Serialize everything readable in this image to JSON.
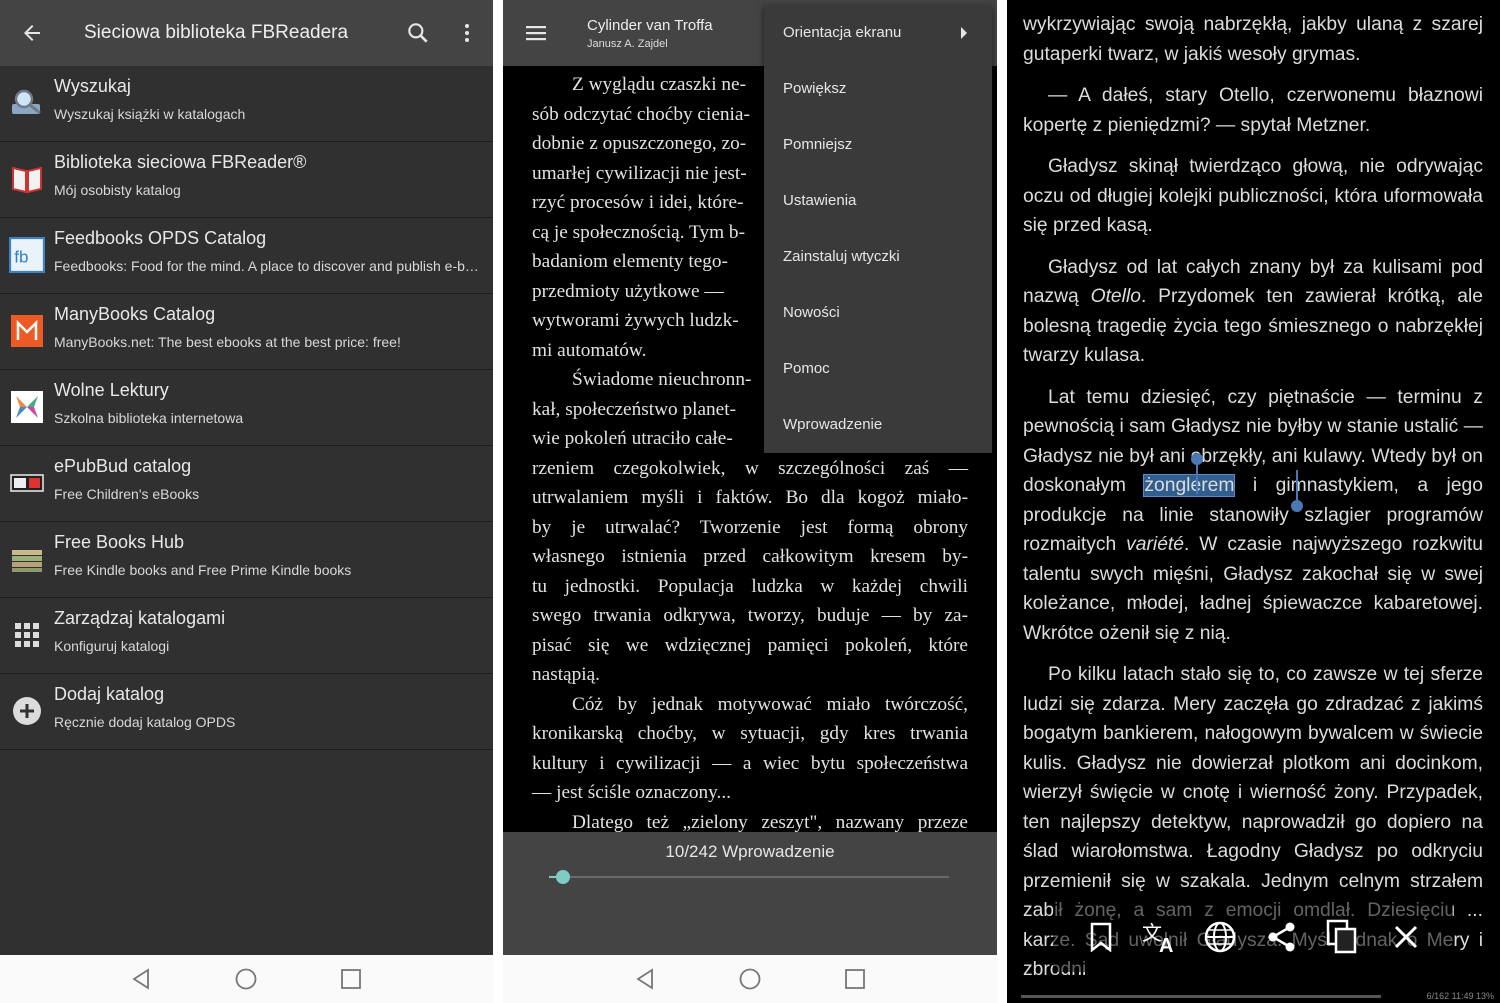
{
  "panel1": {
    "title": "Sieciowa biblioteka FBReadera",
    "items": [
      {
        "title": "Wyszukaj",
        "subtitle": "Wyszukaj książki w katalogach"
      },
      {
        "title": "Biblioteka sieciowa FBReader®",
        "subtitle": "Mój osobisty katalog"
      },
      {
        "title": "Feedbooks OPDS Catalog",
        "subtitle": "Feedbooks: Food for the mind. A place to discover and publish e-boo.."
      },
      {
        "title": "ManyBooks Catalog",
        "subtitle": "ManyBooks.net: The best ebooks at the best price: free!"
      },
      {
        "title": "Wolne Lektury",
        "subtitle": "Szkolna biblioteka internetowa"
      },
      {
        "title": "ePubBud catalog",
        "subtitle": "Free Children's eBooks"
      },
      {
        "title": "Free Books Hub",
        "subtitle": "Free Kindle books and Free Prime Kindle books"
      },
      {
        "title": "Zarządzaj katalogami",
        "subtitle": "Konfiguruj katalogi"
      },
      {
        "title": "Dodaj katalog",
        "subtitle": "Ręcznie dodaj katalog OPDS"
      }
    ]
  },
  "panel2": {
    "book_title": "Cylinder van Troffa",
    "book_author": "Janusz A. Zajdel",
    "menu": [
      "Orientacja ekranu",
      "Powiększ",
      "Pomniejsz",
      "Ustawienia",
      "Zainstaluj wtyczki",
      "Nowości",
      "Pomoc",
      "Wprowadzenie"
    ],
    "page_indicator": "10/242  Wprowadzenie",
    "progress": 0.035,
    "text": [
      "Z wyglądu czaszki ne-",
      "sób odczytać choćby cienia-",
      "dobnie z opuszczonego, zo-",
      "umarłej cywilizacji nie jest-",
      "rzyć procesów i idei, które-",
      "cą je społecznością. Tym b-",
      "badaniom elementy tego-",
      "przedmioty użytkowe —",
      "wytworami żywych ludzk-",
      "mi automatów.",
      "Świadome nieuchronn-",
      "kał, społeczeństwo planet-",
      "wie pokoleń utraciło całe-",
      "rzeniem czegokolwiek, w szczególności zaś —",
      "utrwalaniem myśli i faktów. Bo dla kogoż miało-",
      "by je utrwalać? Tworzenie jest formą obrony",
      "własnego istnienia przed całkowitym kresem by-",
      "tu jednostki. Populacja ludzka w każdej chwili",
      "swego trwania odkrywa, tworzy, buduje — by za-",
      "pisać się we wdzięcznej pamięci pokoleń, które",
      "nastąpią.",
      "Cóż by jednak motywować miało twórczość,",
      "kronikarską choćby, w sytuacji, gdy kres trwania",
      "kultury i cywilizacji — a wiec bytu społeczeństwa",
      "— jest ściśle oznaczony...",
      "Dlatego też „zielony zeszyt\", nazwany przeze"
    ]
  },
  "panel3": {
    "p1": "wykrzywiając swoją nabrzękłą, jakby ulaną z szarej gutaperki twarz, w jakiś wesoły grymas.",
    "p2": "— A dałeś, stary Otello, czerwonemu błaznowi kopertę z pieniędzmi? — spytał Metzner.",
    "p3": "Gładysz skinął twierdząco głową, nie odrywając oczu od długiej kolejki publiczności, która uformowała się przed kasą.",
    "p4a": "Gładysz od lat całych znany był za kulisami pod nazwą ",
    "p4i": "Otello",
    "p4b": ". Przydomek ten zawierał krótką, ale bolesną tragedię życia tego śmiesznego o nabrzękłej twarzy kulasa.",
    "p5a": "Lat temu dziesięć, czy piętnaście — terminu z pewnością i sam Gładysz nie byłby w stanie ustalić — Gładysz nie był ani obrzękły, ani kulawy. Wtedy był on doskonałym ",
    "p5sel": "żonglerem",
    "p5b": " i gimnastykiem, a jego produkcje na linie stanowiły szlagier programów rozmaitych ",
    "p5i": "variété",
    "p5c": ". W czasie najwyższego rozkwitu talentu swych mięśni, Gładysz zakochał się w swej koleżance, młodej, ładnej śpiewaczce kabaretowej. Wkrótce ożenił się z nią.",
    "p6": "Po kilku latach stało się to, co zawsze w tej sferze ludzi się zdarza. Mery zaczęła go zdradzać z jakimś bogatym bankierem, nałogowym bywalcem w świecie kulis. Gładysz nie dowierzał plotkom ani docinkom, wierzył święcie w cnotę i wierność żony. Przypadek, ten najlepszy detektyw, naprowadził go dopiero na ślad wiarołomstwa. Łagodny Gładysz po odkryciu przemienił się w szakala. Jednym celnym strzałem zabił żonę, a sam z emocji omdlał. Dziesięciu ... karze. Sąd uwolnił Gładysza. Myśl jednak o Mery i zbrodni",
    "status": "6/162  11:49  13%"
  }
}
